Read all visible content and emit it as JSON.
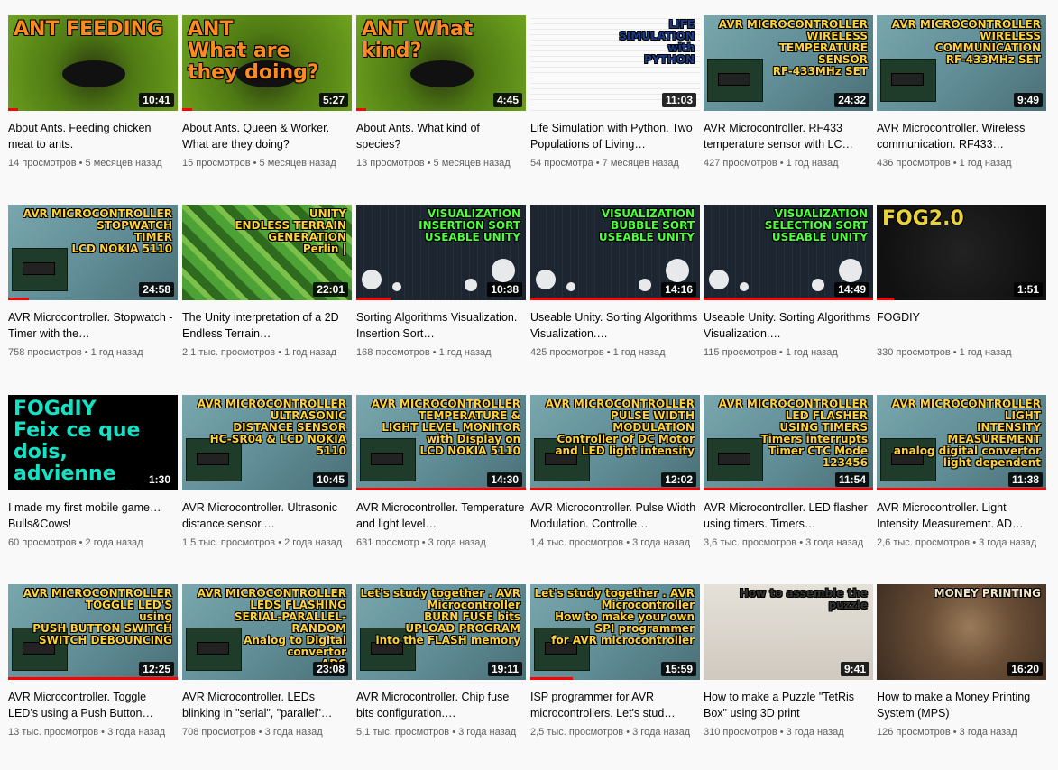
{
  "videos": [
    {
      "thumb_text": "ANT FEEDING",
      "theme": "ant",
      "duration": "10:41",
      "progress": 0.06,
      "title": "About Ants. Feeding chicken meat to ants.",
      "views": "14 просмотров",
      "date": "5 месяцев назад"
    },
    {
      "thumb_text": "ANT\nWhat are they doing?",
      "theme": "ant",
      "duration": "5:27",
      "progress": 0.06,
      "title": "About Ants. Queen & Worker. What are they doing?",
      "views": "15 просмотров",
      "date": "5 месяцев назад"
    },
    {
      "thumb_text": "ANT What kind?",
      "theme": "ant",
      "duration": "4:45",
      "progress": 0.06,
      "title": "About Ants. What kind of species?",
      "views": "13 просмотров",
      "date": "5 месяцев назад"
    },
    {
      "thumb_text": "LIFE\nSIMULATION\nwith\nPYTHON",
      "theme": "python",
      "duration": "11:03",
      "progress": 0.0,
      "title": "Life Simulation with Python. Two Populations of Living…",
      "views": "54 просмотра",
      "date": "7 месяцев назад"
    },
    {
      "thumb_text": "AVR MICROCONTROLLER\nWIRELESS\nTEMPERATURE\nSENSOR\nRF-433MHz SET",
      "theme": "avr",
      "duration": "24:32",
      "progress": 0.0,
      "title": "AVR Microcontroller. RF433 temperature sensor with LC…",
      "views": "427 просмотров",
      "date": "1 год назад"
    },
    {
      "thumb_text": "AVR MICROCONTROLLER\nWIRELESS\nCOMMUNICATION\nRF-433MHz SET",
      "theme": "avr",
      "duration": "9:49",
      "progress": 0.0,
      "title": "AVR Microcontroller. Wireless communication. RF433…",
      "views": "436 просмотров",
      "date": "1 год назад"
    },
    {
      "thumb_text": "AVR MICROCONTROLLER\nSTOPWATCH\nTIMER\nLCD NOKIA 5110",
      "theme": "avr",
      "duration": "24:58",
      "progress": 0.12,
      "title": "AVR Microcontroller. Stopwatch - Timer with the…",
      "views": "758 просмотров",
      "date": "1 год назад"
    },
    {
      "thumb_text": "UNITY\nENDLESS TERRAIN\nGENERATION\nPerlin |",
      "theme": "terrain",
      "duration": "22:01",
      "progress": 0.0,
      "title": "The Unity interpretation of a 2D Endless Terrain…",
      "views": "2,1 тыс. просмотров",
      "date": "1 год назад"
    },
    {
      "thumb_text": "VISUALIZATION\nINSERTION SORT\nUSEABLE UNITY",
      "theme": "sort",
      "duration": "10:38",
      "progress": 0.2,
      "title": "Sorting Algorithms Visualization. Insertion Sort…",
      "views": "168 просмотров",
      "date": "1 год назад"
    },
    {
      "thumb_text": "VISUALIZATION\nBUBBLE SORT\nUSEABLE UNITY",
      "theme": "sort",
      "duration": "14:16",
      "progress": 1.0,
      "title": "Useable Unity. Sorting Algorithms Visualization.…",
      "views": "425 просмотров",
      "date": "1 год назад"
    },
    {
      "thumb_text": "VISUALIZATION\nSELECTION SORT\nUSEABLE UNITY",
      "theme": "sort",
      "duration": "14:49",
      "progress": 1.0,
      "title": "Useable Unity. Sorting Algorithms Visualization.…",
      "views": "115 просмотров",
      "date": "1 год назад"
    },
    {
      "thumb_text": "FOG2.0",
      "theme": "fog",
      "duration": "1:51",
      "progress": 0.1,
      "title": "FOGDIY",
      "views": "330 просмотров",
      "date": "1 год назад"
    },
    {
      "thumb_text": "FOGdIY\nFeix ce que dois,\nadvienne\nque pourra",
      "theme": "fogdiy",
      "duration": "1:30",
      "progress": 0.0,
      "title": "I made my first mobile game… Bulls&Cows!",
      "views": "60 просмотров",
      "date": "2 года назад"
    },
    {
      "thumb_text": "AVR MICROCONTROLLER\nULTRASONIC\nDISTANCE SENSOR\nHC-SR04 & LCD NOKIA 5110",
      "theme": "avr",
      "duration": "10:45",
      "progress": 0.0,
      "title": "AVR Microcontroller. Ultrasonic distance sensor.…",
      "views": "1,5 тыс. просмотров",
      "date": "2 года назад"
    },
    {
      "thumb_text": "AVR MICROCONTROLLER\nTEMPERATURE &\nLIGHT LEVEL MONITOR\nwith Display on\nLCD NOKIA 5110",
      "theme": "avr",
      "duration": "14:30",
      "progress": 1.0,
      "title": "AVR Microcontroller. Temperature and light level…",
      "views": "631 просмотр",
      "date": "3 года назад"
    },
    {
      "thumb_text": "AVR MICROCONTROLLER\nPULSE WIDTH\nMODULATION\nController of DC Motor\nand LED light intensity",
      "theme": "avr",
      "duration": "12:02",
      "progress": 1.0,
      "title": "AVR Microcontroller. Pulse Width Modulation. Controlle…",
      "views": "1,4 тыс. просмотров",
      "date": "3 года назад"
    },
    {
      "thumb_text": "AVR MICROCONTROLLER\nLED FLASHER\nUSING TIMERS\nTimers interrupts\nTimer CTC Mode\n123456",
      "theme": "avr",
      "duration": "11:54",
      "progress": 1.0,
      "title": "AVR Microcontroller. LED flasher using timers. Timers…",
      "views": "3,6 тыс. просмотров",
      "date": "3 года назад"
    },
    {
      "thumb_text": "AVR MICROCONTROLLER\nLIGHT\nINTENSITY\nMEASUREMENT\nanalog digital convertor\nlight dependent",
      "theme": "avr",
      "duration": "11:38",
      "progress": 1.0,
      "title": "AVR Microcontroller. Light Intensity Measurement. AD…",
      "views": "2,6 тыс. просмотров",
      "date": "3 года назад"
    },
    {
      "thumb_text": "AVR MICROCONTROLLER\nTOGGLE LED'S\nusing\nPUSH BUTTON SWITCH\nSWITCH DEBOUNCING",
      "theme": "avr",
      "duration": "12:25",
      "progress": 1.0,
      "title": "AVR Microcontroller. Toggle LED’s using a Push Button…",
      "views": "13 тыс. просмотров",
      "date": "3 года назад"
    },
    {
      "thumb_text": "AVR MICROCONTROLLER\nLEDS FLASHING\nSERIAL-PARALLEL-RANDOM\nAnalog to Digital convertor\nADC",
      "theme": "avr",
      "duration": "23:08",
      "progress": 0.0,
      "title": "AVR Microcontroller. LEDs blinking in \"serial\", \"parallel\"…",
      "views": "708 просмотров",
      "date": "3 года назад"
    },
    {
      "thumb_text": "Let's study together . AVR Microcontroller\nBURN FUSE bits\nUPLOAD PROGRAM\ninto the FLASH memory",
      "theme": "avr",
      "duration": "19:11",
      "progress": 0.0,
      "title": "AVR Microcontroller. Chip fuse bits configuration.…",
      "views": "5,1 тыс. просмотров",
      "date": "3 года назад"
    },
    {
      "thumb_text": "Let's study together . AVR Microcontroller\nHow to make your own\nSPI programmer\nfor AVR microcontroller",
      "theme": "avr",
      "duration": "15:59",
      "progress": 0.25,
      "title": "ISP programmer for AVR microcontrollers. Let's stud…",
      "views": "2,5 тыс. просмотров",
      "date": "3 года назад"
    },
    {
      "thumb_text": "How to assemble the puzzle",
      "theme": "puzzle",
      "duration": "9:41",
      "progress": 0.0,
      "title": "How to make a Puzzle \"TetRis Box\" using 3D print",
      "views": "310 просмотров",
      "date": "3 года назад"
    },
    {
      "thumb_text": "MONEY PRINTING",
      "theme": "money",
      "duration": "16:20",
      "progress": 0.0,
      "title": "How to make a Money Printing System (MPS)",
      "views": "126 просмотров",
      "date": "3 года назад"
    }
  ],
  "theme_colors": {
    "ant": "#6fa31f",
    "python": "#f4f4f4",
    "avr": "#5f8c95",
    "terrain": "#3f7d2a",
    "sort": "#1c2530",
    "fog": "#111111",
    "fogdiy": "#000000",
    "puzzle": "#cfc9c0",
    "money": "#3c2d22"
  }
}
